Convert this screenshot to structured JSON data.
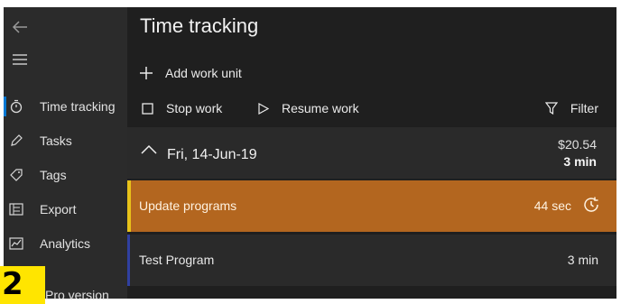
{
  "page": {
    "title": "Time tracking"
  },
  "sidebar": {
    "back_icon": "arrow-left-icon",
    "menu_icon": "hamburger-icon",
    "items": [
      {
        "label": "Time tracking",
        "icon": "stopwatch-icon"
      },
      {
        "label": "Tasks",
        "icon": "pen-icon"
      },
      {
        "label": "Tags",
        "icon": "tag-icon"
      },
      {
        "label": "Export",
        "icon": "export-icon"
      },
      {
        "label": "Analytics",
        "icon": "chart-icon"
      }
    ],
    "pro_label": "Pro version"
  },
  "commands": {
    "add": "Add work unit",
    "stop": "Stop work",
    "resume": "Resume work",
    "filter": "Filter"
  },
  "group": {
    "date": "Fri, 14-Jun-19",
    "money": "$20.54",
    "total": "3 min"
  },
  "entries": [
    {
      "name": "Update programs",
      "duration": "44 sec"
    },
    {
      "name": "Test Program",
      "duration": "3 min"
    }
  ],
  "badge": "2",
  "colors": {
    "accent": "#0078d4",
    "active_row": "#b3661f",
    "active_bar": "#e8c21a",
    "badge": "#ffe500"
  }
}
